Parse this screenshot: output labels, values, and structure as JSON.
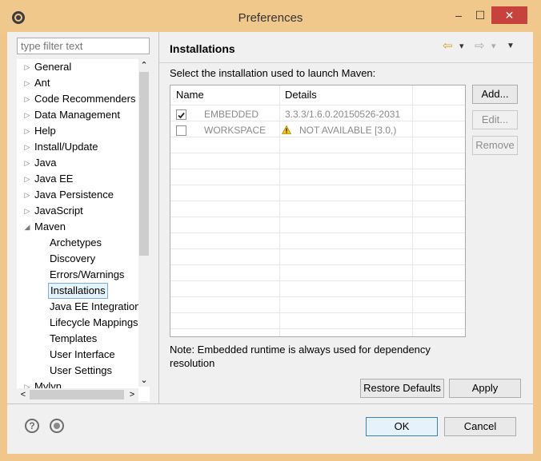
{
  "window": {
    "title": "Preferences",
    "minimize": "–",
    "maximize": "☐",
    "close": "✕"
  },
  "left": {
    "filter_placeholder": "type filter text",
    "tree": [
      {
        "label": "General",
        "arrow": "▷"
      },
      {
        "label": "Ant",
        "arrow": "▷"
      },
      {
        "label": "Code Recommenders",
        "arrow": "▷"
      },
      {
        "label": "Data Management",
        "arrow": "▷"
      },
      {
        "label": "Help",
        "arrow": "▷"
      },
      {
        "label": "Install/Update",
        "arrow": "▷"
      },
      {
        "label": "Java",
        "arrow": "▷"
      },
      {
        "label": "Java EE",
        "arrow": "▷"
      },
      {
        "label": "Java Persistence",
        "arrow": "▷"
      },
      {
        "label": "JavaScript",
        "arrow": "▷"
      },
      {
        "label": "Maven",
        "arrow": "◢"
      },
      {
        "label": "Archetypes"
      },
      {
        "label": "Discovery"
      },
      {
        "label": "Errors/Warnings"
      },
      {
        "label": "Installations"
      },
      {
        "label": "Java EE Integration"
      },
      {
        "label": "Lifecycle Mappings"
      },
      {
        "label": "Templates"
      },
      {
        "label": "User Interface"
      },
      {
        "label": "User Settings"
      },
      {
        "label": "Mylyn",
        "arrow": "▷"
      }
    ],
    "scroll_up": "⌃",
    "scroll_down": "⌄",
    "scroll_left": "<",
    "scroll_right": ">"
  },
  "right": {
    "title": "Installations",
    "nav_back": "⇦",
    "nav_forward": "⇨",
    "nav_drop": "▾",
    "menu": "▼",
    "description": "Select the installation used to launch Maven:",
    "table": {
      "columns": [
        "Name",
        "Details"
      ],
      "rows": [
        {
          "checked": true,
          "name": "EMBEDDED",
          "details": "3.3.3/1.6.0.20150526-2031",
          "warning": false
        },
        {
          "checked": false,
          "name": "WORKSPACE",
          "details": "NOT AVAILABLE [3.0,)",
          "warning": true
        }
      ]
    },
    "buttons": {
      "add": "Add...",
      "edit": "Edit...",
      "remove": "Remove"
    },
    "note": "Note: Embedded runtime is always used for dependency resolution",
    "restore_defaults": "Restore Defaults",
    "apply": "Apply"
  },
  "footer": {
    "help_icon": "?",
    "ok": "OK",
    "cancel": "Cancel"
  }
}
